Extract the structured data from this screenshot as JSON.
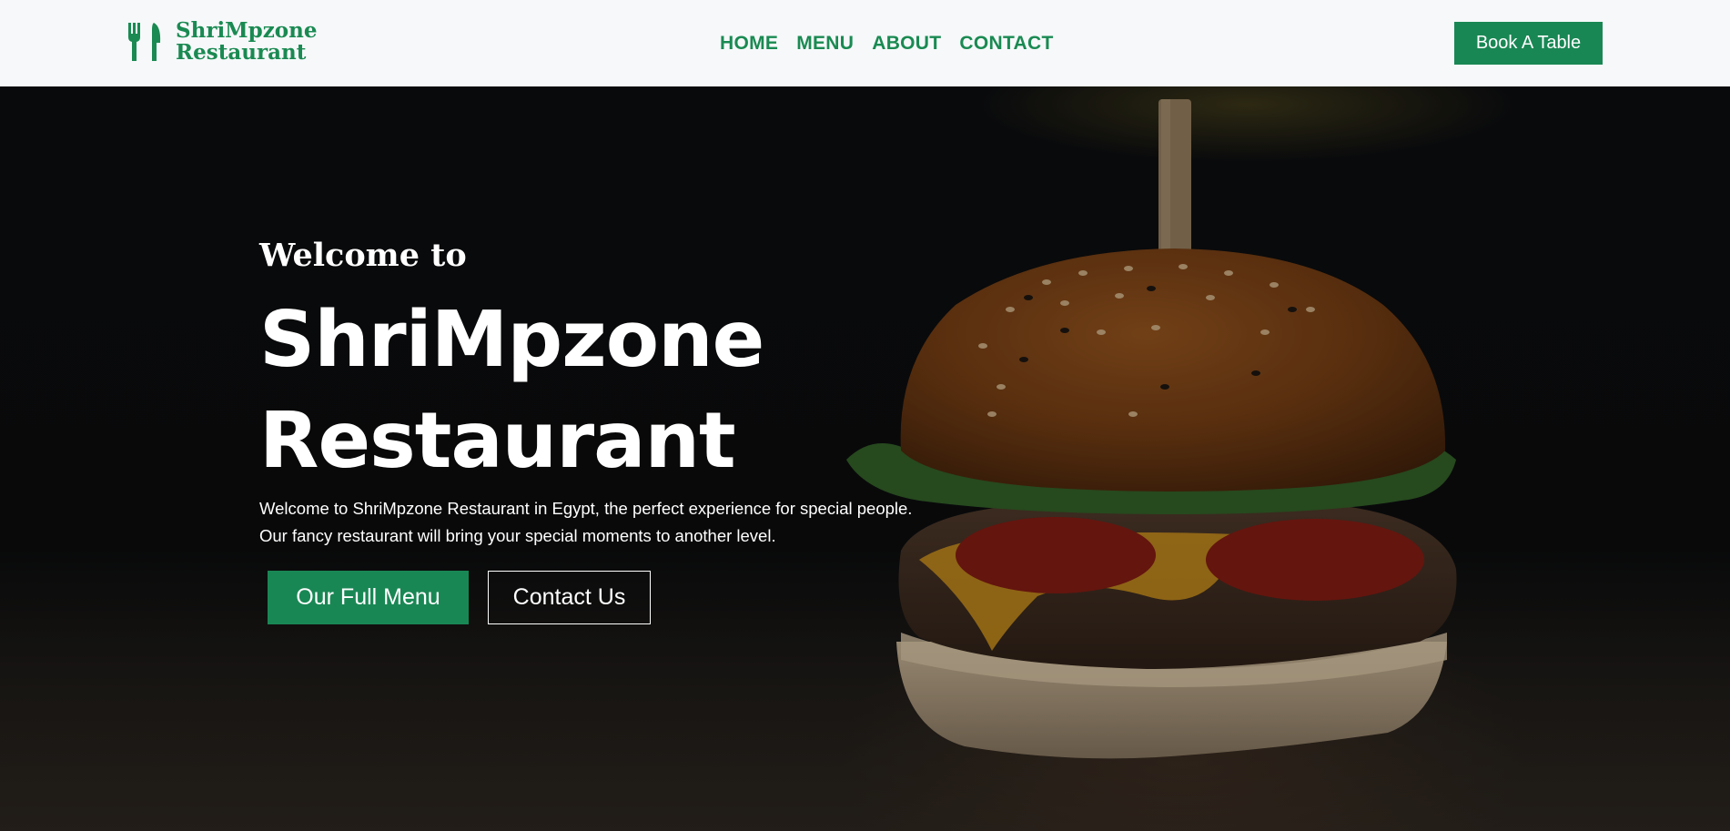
{
  "header": {
    "brand": {
      "line1": "ShriMpzone",
      "line2": "Restaurant",
      "icon": "utensils-icon"
    },
    "nav": [
      {
        "label": "HOME"
      },
      {
        "label": "MENU"
      },
      {
        "label": "ABOUT"
      },
      {
        "label": "CONTACT"
      }
    ],
    "cta_label": "Book A Table"
  },
  "hero": {
    "welcome": "Welcome to",
    "title_line1": "ShriMpzone",
    "title_line2": "Restaurant",
    "desc_line1": "Welcome to ShriMpzone Restaurant in Egypt, the perfect experience for special people.",
    "desc_line2": "Our fancy restaurant will bring your special moments to another level.",
    "primary_button": "Our Full Menu",
    "secondary_button": "Contact Us",
    "background_image": "burger-photo"
  },
  "colors": {
    "brand_green": "#198754",
    "header_bg": "#f6f8f9",
    "hero_text": "#ffffff"
  }
}
